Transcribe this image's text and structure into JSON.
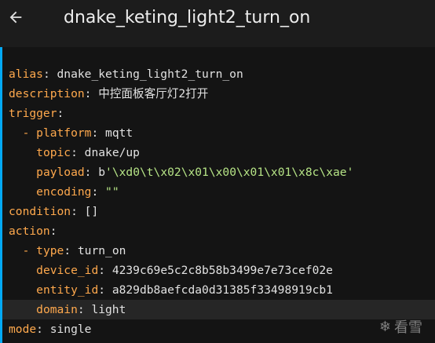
{
  "header": {
    "title": "dnake_keting_light2_turn_on",
    "back_icon": "arrow-left-icon"
  },
  "editor": {
    "alias_key": "alias",
    "alias_value": "dnake_keting_light2_turn_on",
    "description_key": "description",
    "description_value": "中控面板客厅灯2打开",
    "trigger_key": "trigger",
    "platform_key": "platform",
    "platform_value": "mqtt",
    "topic_key": "topic",
    "topic_value": "dnake/up",
    "payload_key": "payload",
    "payload_prefix": "b",
    "payload_value": "'\\xd0\\t\\x02\\x01\\x00\\x01\\x01\\x8c\\xae'",
    "encoding_key": "encoding",
    "encoding_value": "\"\"",
    "condition_key": "condition",
    "condition_value": "[]",
    "action_key": "action",
    "type_key": "type",
    "type_value": "turn_on",
    "device_id_key": "device_id",
    "device_id_value": "4239c69e5c2c8b58b3499e7e73cef02e",
    "entity_id_key": "entity_id",
    "entity_id_value": "a829db8aefcda0d31385f33498919cb1",
    "domain_key": "domain",
    "domain_value": "light",
    "mode_key": "mode",
    "mode_value": "single"
  },
  "watermark": {
    "text": "看雪",
    "icon": "snowflake-icon"
  },
  "colors": {
    "accent": "#03a9f4",
    "key": "#ffa94d",
    "string": "#b6e486"
  }
}
